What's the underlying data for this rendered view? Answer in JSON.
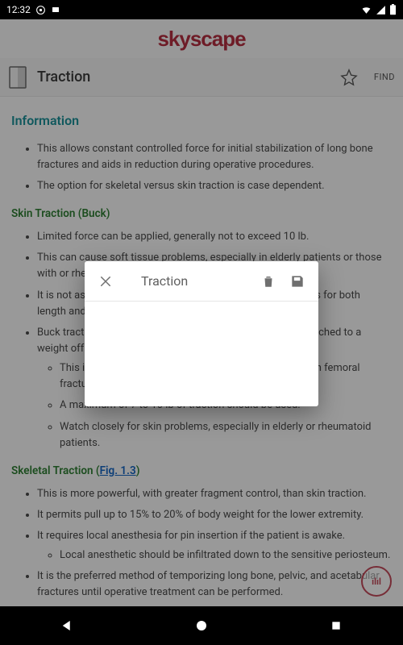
{
  "status": {
    "time": "12:32"
  },
  "brand": "skyscape",
  "header": {
    "title": "Traction",
    "find_label": "FIND"
  },
  "dialog": {
    "title": "Traction"
  },
  "fab": {
    "label": "ılıl"
  },
  "content": {
    "info_heading": "Information",
    "intro_items": [
      "This allows constant controlled force for initial stabilization of long bone fractures and aids in reduction during operative procedures.",
      "The option for skeletal versus skin traction is case dependent."
    ],
    "skin_heading": "Skin Traction (Buck)",
    "skin_items": [
      "Limited force can be applied, generally not to exceed 10 lb.",
      "This can cause soft tissue problems, especially in elderly patients or those with or rheumatoid-type skin.",
      "It is not as powerful; consequently, it is indicated rarely and is for both length and alignment.",
      "Buck traction: a soft dressing around the calf and foot is attached to a weight off the foot of the bed."
    ],
    "skin_sub": [
      "This is an option to provide temporary comfort in certain femoral fractures and certain pediatric fractures.",
      "A maximum of 7 to 10 lb of traction should be used.",
      "Watch closely for skin problems, especially in elderly or rheumatoid patients."
    ],
    "skel_heading_pre": "Skeletal Traction (",
    "skel_heading_link": "Fig. 1.3",
    "skel_heading_post": ")",
    "skel_items": [
      "This is more powerful, with greater fragment control, than skin traction.",
      "It permits pull up to 15% to 20% of body weight for the lower extremity.",
      "It requires local anesthesia for pin insertion if the patient is awake."
    ],
    "skel_sub": [
      "Local anesthetic should be infiltrated down to the sensitive periosteum."
    ],
    "skel_items2": [
      "It is the preferred method of temporizing long bone, pelvic, and acetabular fractures until operative treatment can be performed."
    ]
  }
}
